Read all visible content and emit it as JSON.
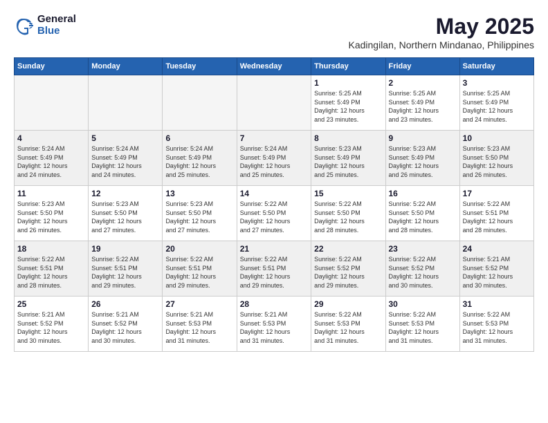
{
  "logo": {
    "general": "General",
    "blue": "Blue"
  },
  "title": {
    "month_year": "May 2025",
    "location": "Kadingilan, Northern Mindanao, Philippines"
  },
  "days_of_week": [
    "Sunday",
    "Monday",
    "Tuesday",
    "Wednesday",
    "Thursday",
    "Friday",
    "Saturday"
  ],
  "weeks": [
    [
      {
        "day": "",
        "info": ""
      },
      {
        "day": "",
        "info": ""
      },
      {
        "day": "",
        "info": ""
      },
      {
        "day": "",
        "info": ""
      },
      {
        "day": "1",
        "info": "Sunrise: 5:25 AM\nSunset: 5:49 PM\nDaylight: 12 hours\nand 23 minutes."
      },
      {
        "day": "2",
        "info": "Sunrise: 5:25 AM\nSunset: 5:49 PM\nDaylight: 12 hours\nand 23 minutes."
      },
      {
        "day": "3",
        "info": "Sunrise: 5:25 AM\nSunset: 5:49 PM\nDaylight: 12 hours\nand 24 minutes."
      }
    ],
    [
      {
        "day": "4",
        "info": "Sunrise: 5:24 AM\nSunset: 5:49 PM\nDaylight: 12 hours\nand 24 minutes."
      },
      {
        "day": "5",
        "info": "Sunrise: 5:24 AM\nSunset: 5:49 PM\nDaylight: 12 hours\nand 24 minutes."
      },
      {
        "day": "6",
        "info": "Sunrise: 5:24 AM\nSunset: 5:49 PM\nDaylight: 12 hours\nand 25 minutes."
      },
      {
        "day": "7",
        "info": "Sunrise: 5:24 AM\nSunset: 5:49 PM\nDaylight: 12 hours\nand 25 minutes."
      },
      {
        "day": "8",
        "info": "Sunrise: 5:23 AM\nSunset: 5:49 PM\nDaylight: 12 hours\nand 25 minutes."
      },
      {
        "day": "9",
        "info": "Sunrise: 5:23 AM\nSunset: 5:49 PM\nDaylight: 12 hours\nand 26 minutes."
      },
      {
        "day": "10",
        "info": "Sunrise: 5:23 AM\nSunset: 5:50 PM\nDaylight: 12 hours\nand 26 minutes."
      }
    ],
    [
      {
        "day": "11",
        "info": "Sunrise: 5:23 AM\nSunset: 5:50 PM\nDaylight: 12 hours\nand 26 minutes."
      },
      {
        "day": "12",
        "info": "Sunrise: 5:23 AM\nSunset: 5:50 PM\nDaylight: 12 hours\nand 27 minutes."
      },
      {
        "day": "13",
        "info": "Sunrise: 5:23 AM\nSunset: 5:50 PM\nDaylight: 12 hours\nand 27 minutes."
      },
      {
        "day": "14",
        "info": "Sunrise: 5:22 AM\nSunset: 5:50 PM\nDaylight: 12 hours\nand 27 minutes."
      },
      {
        "day": "15",
        "info": "Sunrise: 5:22 AM\nSunset: 5:50 PM\nDaylight: 12 hours\nand 28 minutes."
      },
      {
        "day": "16",
        "info": "Sunrise: 5:22 AM\nSunset: 5:50 PM\nDaylight: 12 hours\nand 28 minutes."
      },
      {
        "day": "17",
        "info": "Sunrise: 5:22 AM\nSunset: 5:51 PM\nDaylight: 12 hours\nand 28 minutes."
      }
    ],
    [
      {
        "day": "18",
        "info": "Sunrise: 5:22 AM\nSunset: 5:51 PM\nDaylight: 12 hours\nand 28 minutes."
      },
      {
        "day": "19",
        "info": "Sunrise: 5:22 AM\nSunset: 5:51 PM\nDaylight: 12 hours\nand 29 minutes."
      },
      {
        "day": "20",
        "info": "Sunrise: 5:22 AM\nSunset: 5:51 PM\nDaylight: 12 hours\nand 29 minutes."
      },
      {
        "day": "21",
        "info": "Sunrise: 5:22 AM\nSunset: 5:51 PM\nDaylight: 12 hours\nand 29 minutes."
      },
      {
        "day": "22",
        "info": "Sunrise: 5:22 AM\nSunset: 5:52 PM\nDaylight: 12 hours\nand 29 minutes."
      },
      {
        "day": "23",
        "info": "Sunrise: 5:22 AM\nSunset: 5:52 PM\nDaylight: 12 hours\nand 30 minutes."
      },
      {
        "day": "24",
        "info": "Sunrise: 5:21 AM\nSunset: 5:52 PM\nDaylight: 12 hours\nand 30 minutes."
      }
    ],
    [
      {
        "day": "25",
        "info": "Sunrise: 5:21 AM\nSunset: 5:52 PM\nDaylight: 12 hours\nand 30 minutes."
      },
      {
        "day": "26",
        "info": "Sunrise: 5:21 AM\nSunset: 5:52 PM\nDaylight: 12 hours\nand 30 minutes."
      },
      {
        "day": "27",
        "info": "Sunrise: 5:21 AM\nSunset: 5:53 PM\nDaylight: 12 hours\nand 31 minutes."
      },
      {
        "day": "28",
        "info": "Sunrise: 5:21 AM\nSunset: 5:53 PM\nDaylight: 12 hours\nand 31 minutes."
      },
      {
        "day": "29",
        "info": "Sunrise: 5:22 AM\nSunset: 5:53 PM\nDaylight: 12 hours\nand 31 minutes."
      },
      {
        "day": "30",
        "info": "Sunrise: 5:22 AM\nSunset: 5:53 PM\nDaylight: 12 hours\nand 31 minutes."
      },
      {
        "day": "31",
        "info": "Sunrise: 5:22 AM\nSunset: 5:53 PM\nDaylight: 12 hours\nand 31 minutes."
      }
    ]
  ]
}
